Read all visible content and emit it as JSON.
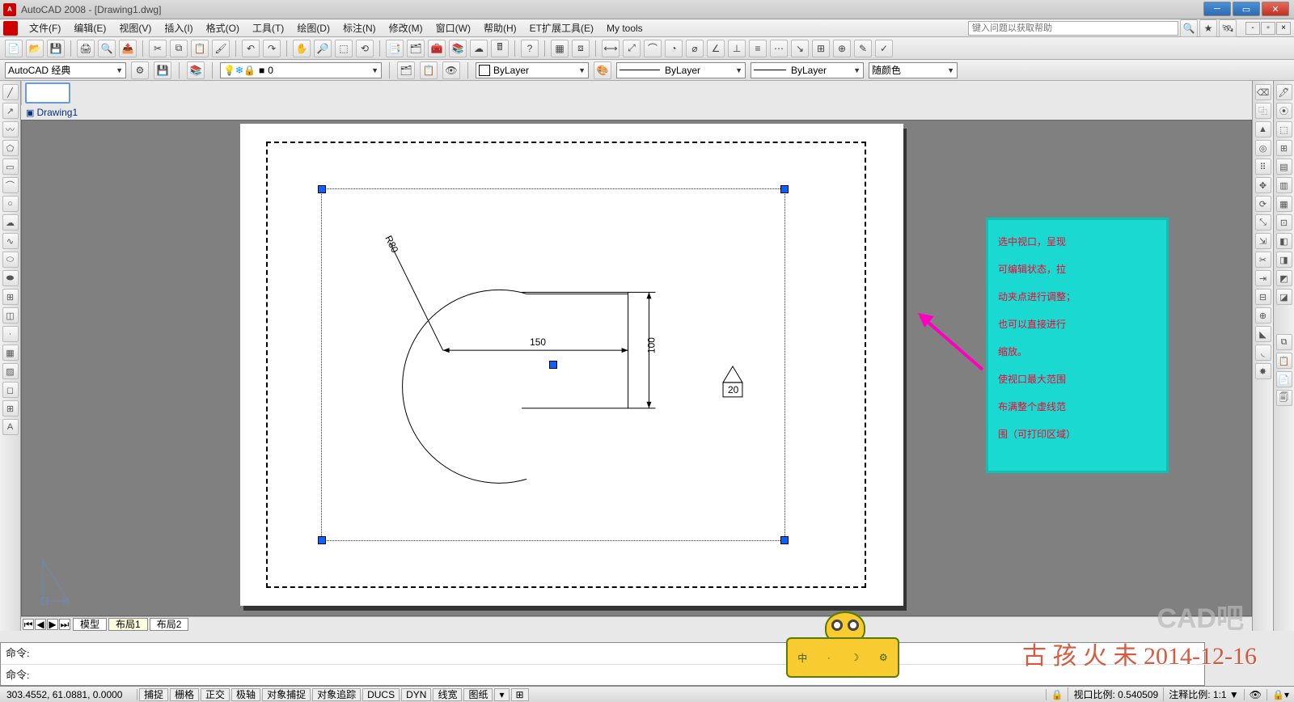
{
  "app": {
    "name": "AutoCAD 2008",
    "doc": "[Drawing1.dwg]"
  },
  "menu": [
    "文件(F)",
    "编辑(E)",
    "视图(V)",
    "插入(I)",
    "格式(O)",
    "工具(T)",
    "绘图(D)",
    "标注(N)",
    "修改(M)",
    "窗口(W)",
    "帮助(H)",
    "ET扩展工具(E)",
    "My tools"
  ],
  "help_placeholder": "键入问题以获取帮助",
  "workspace_combo": "AutoCAD 经典",
  "layer_combo": "0",
  "prop": {
    "color_label": "ByLayer",
    "linetype_label": "ByLayer",
    "lineweight_label": "ByLayer",
    "plotstyle_label": "随颜色"
  },
  "doc_tab": "Drawing1",
  "layout_tabs": [
    "模型",
    "布局1",
    "布局2"
  ],
  "dims": {
    "d150": "150",
    "d100": "100",
    "d20": "20",
    "r80": "R80"
  },
  "annotation": {
    "l1": "选中视口，呈现",
    "l2": "可编辑状态，拉",
    "l3": "动夹点进行调整；",
    "l4": "也可以直接进行",
    "l5": "缩放。",
    "l6": "使视口最大范围",
    "l7": "布满整个虚线范",
    "l8": "围（可打印区域）"
  },
  "cmd": {
    "line1": "命令:",
    "line2": "命令:"
  },
  "status": {
    "coords": "303.4552, 61.0881, 0.0000",
    "toggles": [
      "捕捉",
      "栅格",
      "正交",
      "极轴",
      "对象捕捉",
      "对象追踪",
      "DUCS",
      "DYN",
      "线宽",
      "图纸"
    ],
    "vp_scale_label": "视口比例:",
    "vp_scale": "0.540509",
    "annoscale_label": "注释比例:",
    "annoscale": "1:1"
  },
  "watermark": "古 孩 火 未 2014-12-16",
  "watermark2": "CAD吧",
  "ime": {
    "zhong": "中",
    "moon": "☽",
    "gear": "⚙"
  }
}
